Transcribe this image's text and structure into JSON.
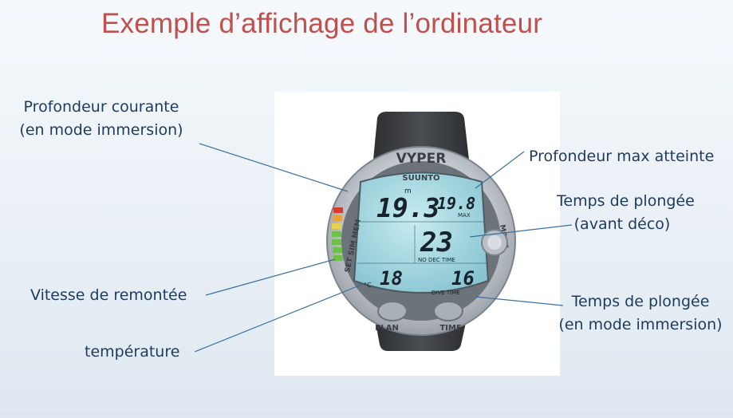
{
  "title": "Exemple d’affichage de l’ordinateur",
  "labels": {
    "profondeur_courante": [
      "Profondeur courante",
      "(en mode immersion)"
    ],
    "vitesse_remontee": "Vitesse de remontée",
    "temperature": "température",
    "profondeur_max": "Profondeur max atteinte",
    "temps_avant_deco": [
      "Temps de plongée",
      "(avant déco)"
    ],
    "temps_immersion": [
      "Temps de plongée",
      "(en mode immersion)"
    ]
  },
  "watch": {
    "brand": "SUUNTO",
    "model": "VYPER",
    "depth_unit": "m",
    "depth": "19.3",
    "max_depth": "19.8",
    "max_label": "MAX",
    "nodec_time": "23",
    "nodec_label": "NO DEC TIME",
    "temperature": "18",
    "temp_unit": "°C",
    "dive_time": "16",
    "dive_time_label": "DIVE TIME",
    "bezel_left": "SET SIM MEM",
    "bezel_right": "MODE",
    "button_left": "PLAN",
    "button_right": "TIME"
  },
  "colors": {
    "title": "#c0504d",
    "label_text": "#1f3a5c",
    "leader_line": "#3b6f9e",
    "lcd_background": "#9ed3de",
    "bezel": "#c7ccd1"
  }
}
